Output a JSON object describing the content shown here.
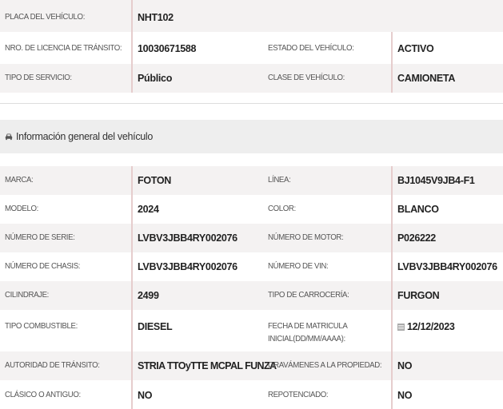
{
  "top_rows": [
    {
      "l1": "PLACA DEL VEHÍCULO:",
      "v1": "NHT102",
      "l2": "",
      "v2": ""
    },
    {
      "l1": "NRO. DE LICENCIA DE TRÁNSITO:",
      "v1": "10030671588",
      "l2": "ESTADO DEL VEHÍCULO:",
      "v2": "ACTIVO"
    },
    {
      "l1": "TIPO DE SERVICIO:",
      "v1": "Público",
      "l2": "CLASE DE VEHÍCULO:",
      "v2": "CAMIONETA"
    }
  ],
  "section": {
    "icon": "car-icon",
    "title": "Información general del vehículo"
  },
  "general_rows": [
    {
      "l1": "MARCA:",
      "v1": "FOTON",
      "l2": "LÍNEA:",
      "v2": "BJ1045V9JB4-F1"
    },
    {
      "l1": "MODELO:",
      "v1": "2024",
      "l2": "COLOR:",
      "v2": "BLANCO"
    },
    {
      "l1": "NÚMERO DE SERIE:",
      "v1": "LVBV3JBB4RY002076",
      "l2": "NÚMERO DE MOTOR:",
      "v2": "P026222"
    },
    {
      "l1": "NÚMERO DE CHASIS:",
      "v1": "LVBV3JBB4RY002076",
      "l2": "NÚMERO DE VIN:",
      "v2": "LVBV3JBB4RY002076"
    },
    {
      "l1": "CILINDRAJE:",
      "v1": "2499",
      "l2": "TIPO DE CARROCERÍA:",
      "v2": "FURGON"
    },
    {
      "l1": "TIPO COMBUSTIBLE:",
      "v1": "DIESEL",
      "l2a": "FECHA DE MATRICULA",
      "l2b": "INICIAL(DD/MM/AAAA):",
      "v2": "12/12/2023",
      "v2_icon": "calendar-icon"
    },
    {
      "l1": "AUTORIDAD DE TRÁNSITO:",
      "v1": "STRIA TTOyTTE MCPAL FUNZA",
      "l2": "GRAVÁMENES A LA PROPIEDAD:",
      "v2": "NO"
    },
    {
      "l1": "CLÁSICO O ANTIGUO:",
      "v1": "NO",
      "l2": "REPOTENCIADO:",
      "v2": "NO"
    }
  ],
  "colors": {
    "row_shade": "#f4f2f2",
    "divider": "#e6cdcd",
    "section_bg": "#eeeeee"
  }
}
